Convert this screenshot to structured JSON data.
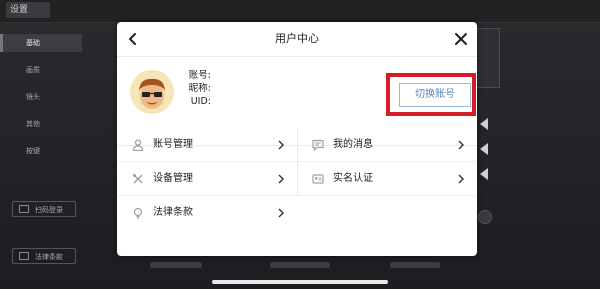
{
  "background": {
    "back_label": "设置",
    "menu": [
      "基础",
      "画质",
      "镜头",
      "其他",
      "按键"
    ],
    "scan_login": "扫码登录",
    "legal_terms": "法律条款"
  },
  "dialog": {
    "title": "用户中心",
    "profile": {
      "account_label": "账号:",
      "nickname_label": "昵称:",
      "uid_label": "UID:"
    },
    "switch_account": "切换账号",
    "menu": {
      "account_manage": "账号管理",
      "my_messages": "我的消息",
      "device_manage": "设备管理",
      "real_name": "实名认证",
      "legal": "法律条款"
    }
  },
  "colors": {
    "highlight": "#d51d28",
    "switch_text": "#5b86b8",
    "icon_gray": "#9aa0a8"
  }
}
